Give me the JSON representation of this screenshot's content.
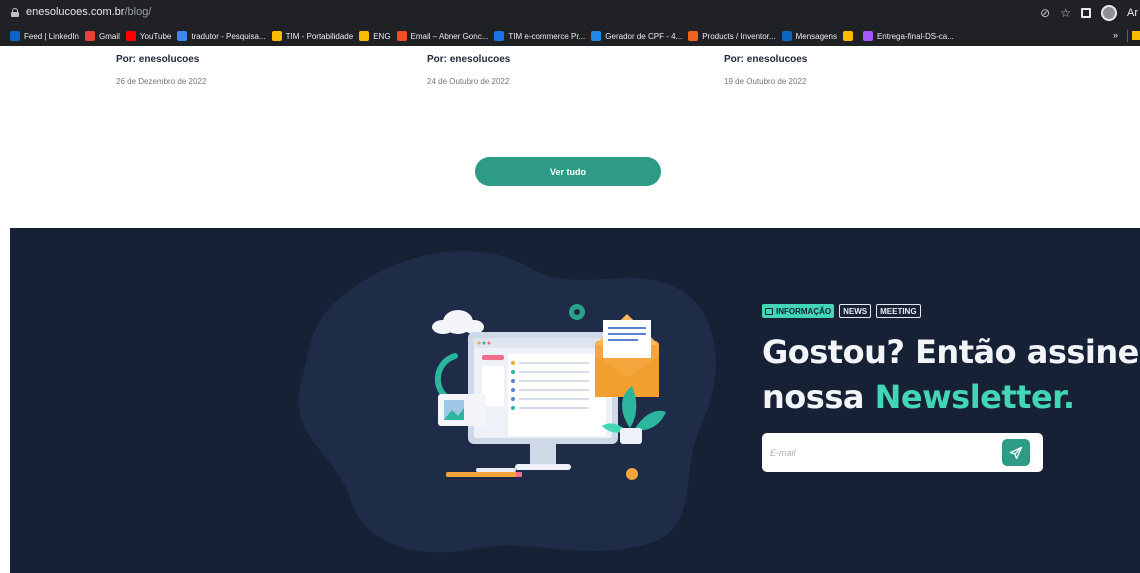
{
  "browser": {
    "url_host": "enesolucoes.com.br",
    "url_path": "/blog/",
    "profile_initial": "Ar",
    "bookmarks": [
      {
        "label": "Feed | LinkedIn",
        "color": "#0a66c2"
      },
      {
        "label": "Gmail",
        "color": "#ea4335"
      },
      {
        "label": "YouTube",
        "color": "#ff0000"
      },
      {
        "label": "tradutor - Pesquisa...",
        "color": "#4285f4"
      },
      {
        "label": "TIM - Portabilidade",
        "color": "#fbbc04"
      },
      {
        "label": "ENG",
        "color": "#fbbc04"
      },
      {
        "label": "Email – Abner Gonc...",
        "color": "#f25022"
      },
      {
        "label": "TIM e-commerce Pr...",
        "color": "#1a73e8"
      },
      {
        "label": "Gerador de CPF - 4...",
        "color": "#1e88e5"
      },
      {
        "label": "Products / Inventor...",
        "color": "#f26322"
      },
      {
        "label": "Mensagens",
        "color": "#0a66c2"
      },
      {
        "label": "",
        "color": "#fbbc04"
      },
      {
        "label": "Entrega-final-DS-ca...",
        "color": "#a259ff"
      }
    ],
    "more_label": "»"
  },
  "posts": [
    {
      "author": "Por: enesolucoes",
      "date": "26 de Dezembro de 2022"
    },
    {
      "author": "Por: enesolucoes",
      "date": "24 de Outubro de 2022"
    },
    {
      "author": "Por: enesolucoes",
      "date": "19 de Outubro de 2022"
    }
  ],
  "blog": {
    "view_all_label": "Ver tudo"
  },
  "newsletter": {
    "tags": [
      "INFORMAÇÃO",
      "NEWS",
      "MEETING"
    ],
    "headline_line1": "Gostou? Então assine",
    "headline_line2_plain": "nossa ",
    "headline_line2_accent": "Newsletter.",
    "email_placeholder": "E-mail"
  },
  "colors": {
    "accent": "#2e9b87",
    "highlight": "#43d6b4",
    "section_bg": "#162136"
  }
}
